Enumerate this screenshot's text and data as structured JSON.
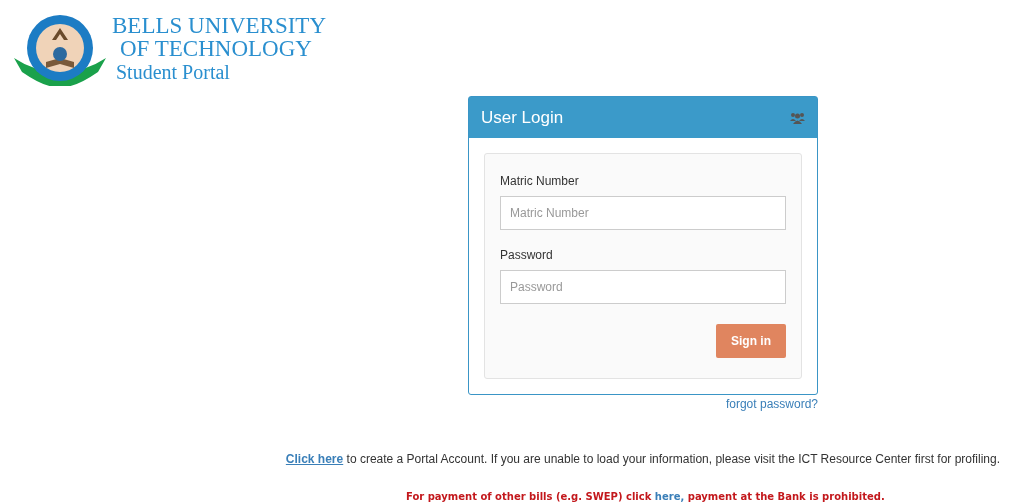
{
  "logo": {
    "line_1": "BELLS UNIVERSITY",
    "line_2": "OF TECHNOLOGY",
    "line_3": "Student Portal"
  },
  "login_panel": {
    "title": "User Login",
    "fields": [
      {
        "label": "Matric Number",
        "placeholder": "Matric Number"
      },
      {
        "label": "Password",
        "placeholder": "Password"
      }
    ],
    "submit": "Sign in",
    "forgot_link": "forgot password?"
  },
  "account_notice": {
    "link": "Click here",
    "text": " to create a Portal Account. If you are unable to load your information, please visit the ICT Resource Center first for profiling."
  },
  "payment_notice": {
    "before": "For payment of other bills (e.g. SWEP) click ",
    "link": "here,",
    "after": " payment at the Bank is prohibited."
  }
}
